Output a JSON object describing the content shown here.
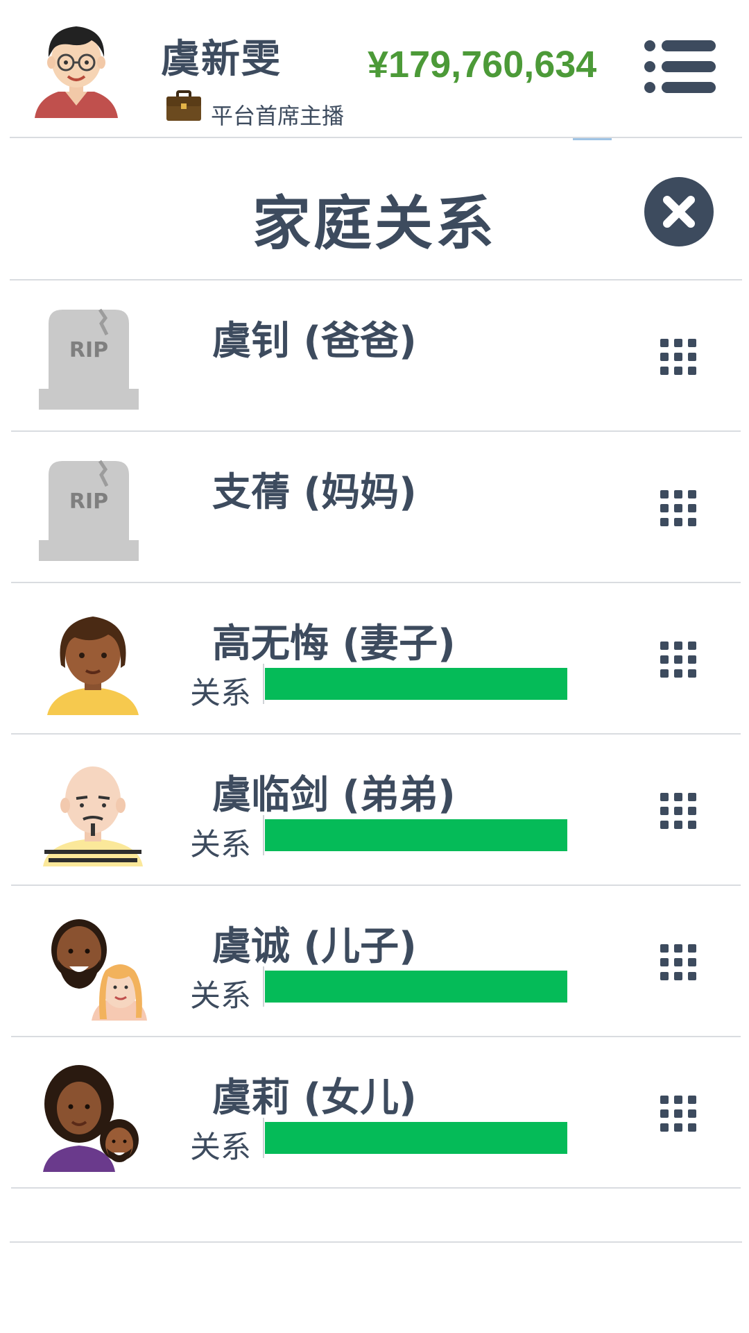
{
  "header": {
    "player_name": "虞新雯",
    "player_title": "平台首席主播",
    "money": "¥179,760,634",
    "avatar_icon": "player-avatar-icon",
    "menu_icon": "menu-list-icon"
  },
  "panel": {
    "title": "家庭关系",
    "close_icon": "close-icon"
  },
  "family": [
    {
      "name": "虞钊 (爸爸)",
      "deceased": true,
      "avatar": "tombstone-rip-icon",
      "rip_text": "RIP"
    },
    {
      "name": "支蒨 (妈妈)",
      "deceased": true,
      "avatar": "tombstone-rip-icon",
      "rip_text": "RIP"
    },
    {
      "name": "高无悔 (妻子)",
      "deceased": false,
      "avatar": "wife-avatar-icon",
      "relation_label": "关系",
      "relation": 1.0
    },
    {
      "name": "虞临剑 (弟弟)",
      "deceased": false,
      "avatar": "brother-avatar-icon",
      "relation_label": "关系",
      "relation": 1.0
    },
    {
      "name": "虞诚 (儿子)",
      "deceased": false,
      "avatar": "son-couple-avatar-icon",
      "relation_label": "关系",
      "relation": 1.0
    },
    {
      "name": "虞莉 (女儿)",
      "deceased": false,
      "avatar": "daughter-couple-avatar-icon",
      "relation_label": "关系",
      "relation": 1.0
    }
  ],
  "colors": {
    "text": "#3d4b5e",
    "money": "#4c9a38",
    "relation_bar": "#05bb58",
    "divider": "#d9dce0"
  }
}
